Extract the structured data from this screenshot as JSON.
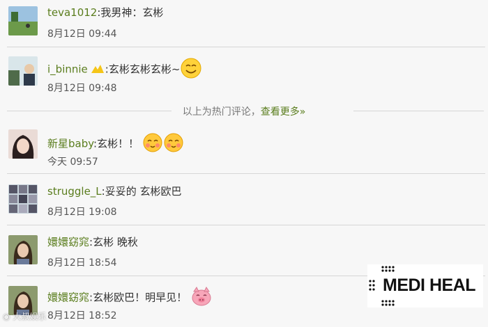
{
  "comments": [
    {
      "user": "teva1012",
      "text": "我男神：玄彬",
      "time": "8月12日 09:44"
    },
    {
      "user": "i_binnie",
      "text": "玄彬玄彬玄彬~",
      "time": "8月12日 09:48"
    },
    {
      "user": "新星baby",
      "text": "玄彬！！",
      "time": "今天 09:57"
    },
    {
      "user": "struggle_L",
      "text": "妥妥的 玄彬欧巴",
      "time": "8月12日 19:08"
    },
    {
      "user": "嬛嬛窈窕",
      "text": "玄彬 晚秋",
      "time": "8月12日 18:54"
    },
    {
      "user": "嬛嬛窈窕",
      "text": "玄彬欧巴！明早见！",
      "time": "8月12日 18:52"
    }
  ],
  "separator": ":",
  "hot": {
    "text": "以上为热门评论，",
    "link": "查看更多»"
  },
  "watermark": {
    "logo": "MEDI HEAL",
    "corner": "大叔娱乐"
  },
  "colors": {
    "username": "#5a7d1d",
    "background": "#f7f7f7"
  },
  "icons": {
    "emoji": "smile-emoji-icon",
    "badge": "vip-badge-icon"
  }
}
